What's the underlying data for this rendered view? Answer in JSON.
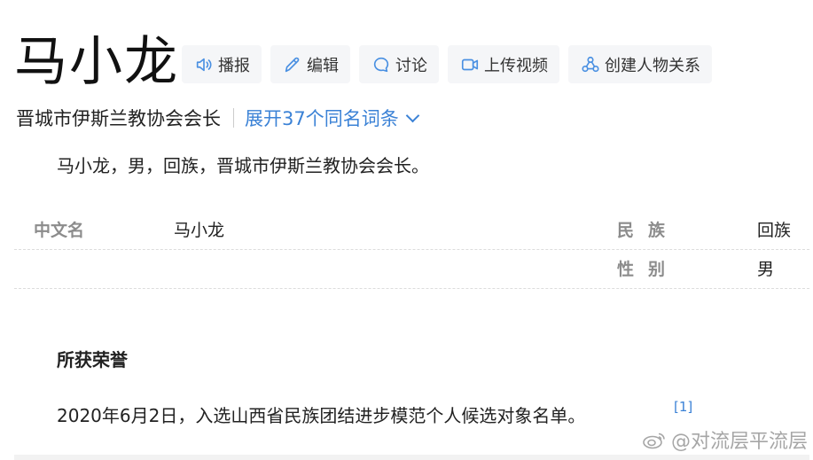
{
  "title": "马小龙",
  "actions": [
    {
      "label": "播报",
      "icon": "speaker-icon"
    },
    {
      "label": "编辑",
      "icon": "pencil-icon"
    },
    {
      "label": "讨论",
      "icon": "chat-bubble-icon"
    },
    {
      "label": "上传视频",
      "icon": "video-camera-icon"
    },
    {
      "label": "创建人物关系",
      "icon": "relationship-icon"
    }
  ],
  "subtitle": "晋城市伊斯兰教协会会长",
  "expand_link": "展开37个同名词条",
  "summary": "马小龙，男，回族，晋城市伊斯兰教协会会长。",
  "info": {
    "rows": [
      {
        "left_label": "中文名",
        "left_value": "马小龙",
        "right_label": "民族",
        "right_value": "回族"
      },
      {
        "left_label": "",
        "left_value": "",
        "right_label": "性别",
        "right_value": "男"
      }
    ]
  },
  "honors": {
    "title": "所获荣誉",
    "text": "2020年6月2日，入选山西省民族团结进步模范个人候选对象名单。",
    "ref": "[1]"
  },
  "watermark": "@对流层平流层",
  "colors": {
    "accent": "#3b82d6",
    "button_bg": "#f5f6f8",
    "label_gray": "#8c8c8c"
  }
}
